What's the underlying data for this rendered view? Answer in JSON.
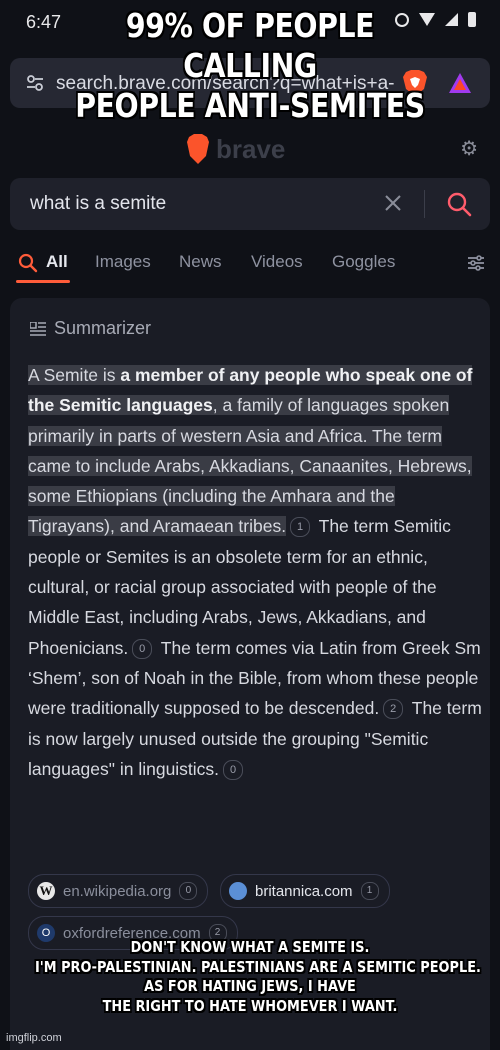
{
  "status_bar": {
    "time": "6:47"
  },
  "browser": {
    "url": "search.brave.com/search?q=what+is+a-",
    "logo_text": "brave"
  },
  "search": {
    "query": "what is a semite",
    "clear_icon": "close-icon",
    "submit_icon": "search-icon"
  },
  "tabs": [
    {
      "label": "All",
      "active": true
    },
    {
      "label": "Images"
    },
    {
      "label": "News"
    },
    {
      "label": "Videos"
    },
    {
      "label": "Goggles"
    }
  ],
  "summarizer": {
    "label": "Summarizer",
    "p1": "A Semite is ",
    "p1_bold": "a member of any people who speak one of the Semitic languages",
    "p1_rest": ", a family of languages spoken primarily in parts of western Asia and Africa. The term came to include Arabs, Akkadians, Canaanites, Hebrews, some Ethiopians (including the Amhara and the Tigrayans), and Aramaean tribes.",
    "c1": "1",
    "p2": " The term Semitic people or Semites is an obsolete term for an ethnic, cultural, or racial group associated with people of the Middle East, including Arabs, Jews, Akkadians, and Phoenicians.",
    "c2": "0",
    "p3": " The term comes via Latin from Greek Sm ‘Shem’, son of Noah in the Bible, from whom these people were traditionally supposed to be descended.",
    "c3": "2",
    "p4": " The term is now largely unused outside the grouping \"Semitic languages\" in linguistics.",
    "c4": "0"
  },
  "sources": [
    {
      "name": "en.wikipedia.org",
      "count": "0"
    },
    {
      "name": "britannica.com",
      "count": "1"
    },
    {
      "name": "oxfordreference.com",
      "count": "2"
    }
  ],
  "meme": {
    "top": [
      "99% OF PEOPLE",
      "CALLING",
      "PEOPLE ANTI-SEMITES"
    ],
    "bottom": [
      "DON'T KNOW WHAT A SEMITE IS.",
      "I'M PRO-PALESTINIAN. PALESTINIANS ARE A SEMITIC PEOPLE.",
      "AS FOR HATING JEWS, I HAVE",
      "THE RIGHT TO HATE WHOMEVER I WANT."
    ],
    "watermark": "imgflip.com"
  },
  "colors": {
    "accent": "#ff5c3a",
    "background": "#0f1117",
    "card": "#1a1c25"
  }
}
